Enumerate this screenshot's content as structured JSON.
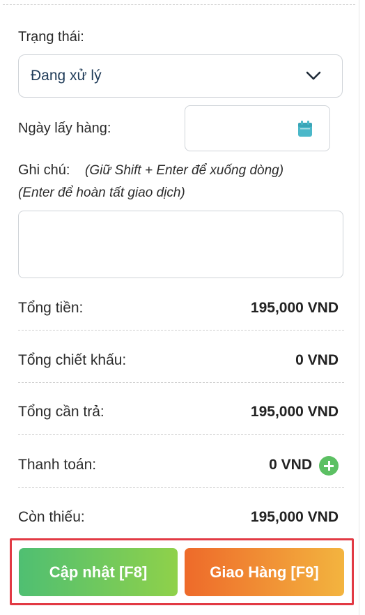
{
  "form": {
    "status_label": "Trạng thái:",
    "status_value": "Đang xử lý",
    "pickup_date_label": "Ngày lấy hàng:",
    "pickup_date_value": "",
    "note_label": "Ghi chú:",
    "note_hint_1": "(Giữ Shift + Enter để xuống dòng)",
    "note_hint_2": "(Enter để hoàn tất giao dịch)",
    "note_value": ""
  },
  "summary": {
    "total_label": "Tổng tiền:",
    "total_value": "195,000 VND",
    "discount_label": "Tổng chiết khấu:",
    "discount_value": "0 VND",
    "payable_label": "Tổng cần trả:",
    "payable_value": "195,000 VND",
    "payment_label": "Thanh toán:",
    "payment_value": "0 VND",
    "remaining_label": "Còn thiếu:",
    "remaining_value": "195,000 VND"
  },
  "actions": {
    "update_label": "Cập nhật [F8]",
    "deliver_label": "Giao Hàng [F9]"
  },
  "colors": {
    "update_gradient": [
      "#4fbf72",
      "#8fd14a"
    ],
    "deliver_gradient": [
      "#ee6a2a",
      "#f3b43f"
    ],
    "highlight_border": "#e23a44",
    "add_payment": "#5cc063",
    "calendar_icon": "#4bb8c9"
  },
  "icons": {
    "status_dropdown": "chevron-down-icon",
    "date_picker": "calendar-icon",
    "add_payment": "plus-circle-icon"
  }
}
